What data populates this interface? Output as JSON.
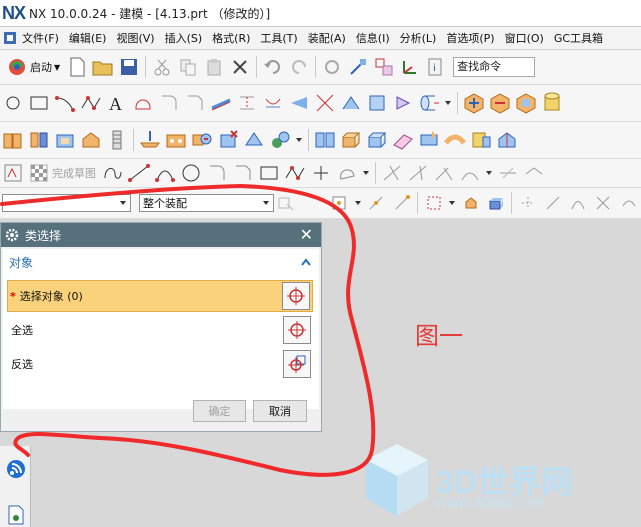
{
  "window": {
    "logo": "NX",
    "title": "NX 10.0.0.24 - 建模 - [4.13.prt （修改的）]"
  },
  "menu": [
    "文件(F)",
    "编辑(E)",
    "视图(V)",
    "插入(S)",
    "格式(R)",
    "工具(T)",
    "装配(A)",
    "信息(I)",
    "分析(L)",
    "首选项(P)",
    "窗口(O)",
    "GC工具箱"
  ],
  "toolbar": {
    "start_label": "启动",
    "search_placeholder": "查找命令",
    "finish_sketch": "完成草图"
  },
  "filters": {
    "type_filter_value": "",
    "assembly_scope": "整个装配"
  },
  "dialog": {
    "title": "类选择",
    "group_label": "对象",
    "select_objects": "选择对象 (0)",
    "select_all": "全选",
    "invert": "反选",
    "ok": "确定",
    "cancel": "取消"
  },
  "annotation": "图一",
  "watermark": {
    "brand": "3D世界网",
    "url": "WWW.3DSJW.COM"
  },
  "colors": {
    "dialog_title": "#56707c",
    "selected_row": "#fad27b",
    "annotation": "#e53b3b",
    "accent": "#2a6fb4"
  }
}
